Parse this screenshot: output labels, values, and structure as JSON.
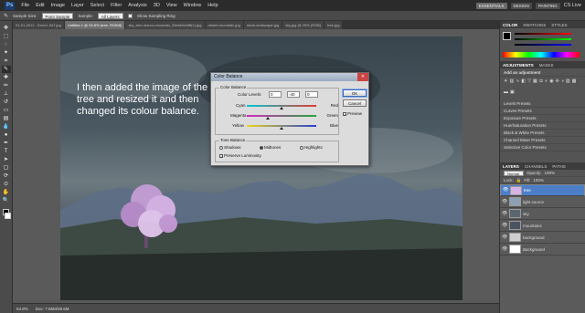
{
  "menubar": {
    "app_badge": "Ps",
    "items": [
      "File",
      "Edit",
      "Image",
      "Layer",
      "Select",
      "Filter",
      "Analysis",
      "3D",
      "View",
      "Window",
      "Help"
    ],
    "workspaces": [
      "ESSENTIALS",
      "DESIGN",
      "PAINTING"
    ],
    "cs_live": "CS Live"
  },
  "options": {
    "sample_size_label": "Sample Size:",
    "sample_size_value": "Point Sample",
    "sample_label": "Sample:",
    "sample_value": "All Layers",
    "show_ring_label": "Show Sampling Ring"
  },
  "tabs": [
    "01-01-2012 - Enzo1-947.jpg",
    "Untitled-1 @ 54.8% (tree, RGB/8)",
    "sky_tree-marco-mountain_25ebe0eb8f(1).jpg",
    "desert-mountain.jpg",
    "stock-landscape.jpg",
    "sky.jpg @ 25% (RGB)",
    "tree.jpg"
  ],
  "canvas": {
    "caption": "I then added the image of the tree and resized it and then changed its colour balance."
  },
  "statusbar": {
    "zoom": "54.8%",
    "doc": "Doc: 7.65M/39.6M"
  },
  "dialog": {
    "title": "Color Balance",
    "group1_label": "Color Balance",
    "color_levels_label": "Color Levels:",
    "levels": [
      "0",
      "-40",
      "0"
    ],
    "sliders": [
      {
        "left": "Cyan",
        "right": "Red",
        "value": 0
      },
      {
        "left": "Magenta",
        "right": "Green",
        "value": -40
      },
      {
        "left": "Yellow",
        "right": "Blue",
        "value": 0
      }
    ],
    "group2_label": "Tone Balance",
    "tones": [
      "Shadows",
      "Midtones",
      "Highlights"
    ],
    "selected_tone": "Midtones",
    "preserve_luminosity": "Preserve Luminosity",
    "ok": "OK",
    "cancel": "Cancel",
    "preview": "Preview"
  },
  "panels": {
    "color_tabs": [
      "COLOR",
      "SWATCHES",
      "STYLES"
    ],
    "adjust_tabs": [
      "ADJUSTMENTS",
      "MASKS"
    ],
    "add_adjustment": "Add an adjustment",
    "presets": [
      "Levels Presets",
      "Curves Presets",
      "Exposure Presets",
      "Hue/Saturation Presets",
      "Black & White Presets",
      "Channel Mixer Presets",
      "Selective Color Presets"
    ],
    "layer_tabs": [
      "LAYERS",
      "CHANNELS",
      "PATHS"
    ],
    "blend_mode": "Normal",
    "opacity_label": "Opacity:",
    "opacity": "100%",
    "lock_label": "Lock:",
    "fill_label": "Fill:",
    "fill": "100%",
    "layers": [
      "tree",
      "light source",
      "sky",
      "mountains",
      "background",
      "Background"
    ]
  }
}
